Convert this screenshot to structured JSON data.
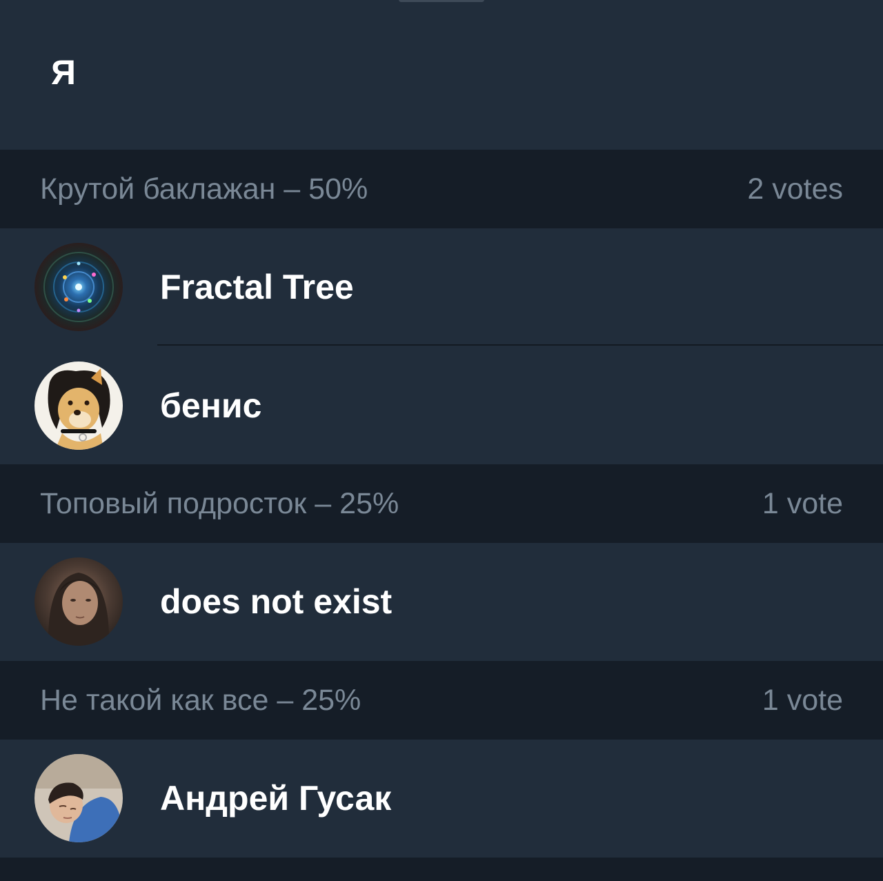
{
  "poll": {
    "title": "Я"
  },
  "options": [
    {
      "label": "Крутой баклажан – 50%",
      "votes_label": "2 votes",
      "voters": [
        {
          "name": "Fractal Tree",
          "avatar": "fractal-tree-avatar"
        },
        {
          "name": "бенис",
          "avatar": "dog-avatar"
        }
      ]
    },
    {
      "label": "Топовый подросток – 25%",
      "votes_label": "1 vote",
      "voters": [
        {
          "name": "does not exist",
          "avatar": "person-avatar"
        }
      ]
    },
    {
      "label": "Не такой как все – 25%",
      "votes_label": "1 vote",
      "voters": [
        {
          "name": "Андрей Гусак",
          "avatar": "person-avatar"
        }
      ]
    }
  ],
  "colors": {
    "background": "#212d3b",
    "header_background": "#151d27",
    "header_text": "#7a8896",
    "name_text": "#ffffff"
  }
}
